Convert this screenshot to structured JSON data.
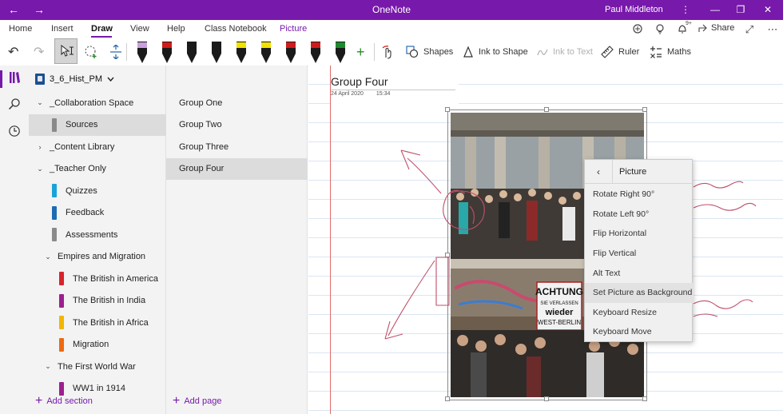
{
  "window": {
    "app_title": "OneNote",
    "user_name": "Paul Middleton",
    "back_glyph": "←",
    "forward_glyph": "→",
    "more_glyph": "⋮",
    "minimize_glyph": "—",
    "restore_glyph": "❐",
    "close_glyph": "✕"
  },
  "menu": {
    "tabs": [
      "Home",
      "Insert",
      "Draw",
      "View",
      "Help",
      "Class Notebook",
      "Picture"
    ],
    "active_tab": "Draw",
    "notification_count": "9+",
    "share_label": "Share",
    "expand_glyph": "⤢",
    "more_glyph": "⋯"
  },
  "ribbon": {
    "undo_glyph": "↶",
    "redo_glyph": "↷",
    "lasso_glyph": "◌",
    "space_glyph": "⇕",
    "add_pen_glyph": "+",
    "shapes_label": "Shapes",
    "ink_to_shape_label": "Ink to Shape",
    "ink_to_text_label": "Ink to Text",
    "ruler_label": "Ruler",
    "maths_label": "Maths",
    "pens": [
      {
        "body": "#1a1a1a",
        "tip": "#1a1a1a",
        "band": "#c9a0dc"
      },
      {
        "body": "#1a1a1a",
        "tip": "#1a1a1a",
        "band": "#d11b1b"
      },
      {
        "body": "#1a1a1a",
        "tip": "#1a1a1a",
        "band": "#1a1a1a"
      },
      {
        "body": "#1a1a1a",
        "tip": "#1a1a1a",
        "band": "#1a1a1a"
      },
      {
        "body": "#1a1a1a",
        "tip": "#1a1a1a",
        "band": "#f2e200"
      },
      {
        "body": "#1a1a1a",
        "tip": "#1a1a1a",
        "band": "#f2e200"
      },
      {
        "body": "#1a1a1a",
        "tip": "#1a1a1a",
        "band": "#d11b1b"
      },
      {
        "body": "#1a1a1a",
        "tip": "#1a1a1a",
        "band": "#d11b1b"
      },
      {
        "body": "#1a1a1a",
        "tip": "#1a1a1a",
        "band": "#1d8a2e"
      }
    ]
  },
  "notebook": {
    "name": "3_6_Hist_PM",
    "sort_glyph": "⇅",
    "sections": [
      {
        "label": "_Collaboration Space",
        "kind": "group",
        "chevron": "⌄",
        "indent": 0,
        "color": ""
      },
      {
        "label": "Sources",
        "kind": "section",
        "chevron": "",
        "indent": 1,
        "color": "#8a8a8a",
        "selected": true
      },
      {
        "label": "_Content Library",
        "kind": "group",
        "chevron": "›",
        "indent": 0,
        "color": ""
      },
      {
        "label": "_Teacher Only",
        "kind": "group",
        "chevron": "⌄",
        "indent": 0,
        "color": ""
      },
      {
        "label": "Quizzes",
        "kind": "section",
        "chevron": "",
        "indent": 1,
        "color": "#19a3d9"
      },
      {
        "label": "Feedback",
        "kind": "section",
        "chevron": "",
        "indent": 1,
        "color": "#1d6bb5"
      },
      {
        "label": "Assessments",
        "kind": "section",
        "chevron": "",
        "indent": 1,
        "color": "#8a8a8a"
      },
      {
        "label": "Empires and Migration",
        "kind": "group",
        "chevron": "⌄",
        "indent": 1,
        "color": ""
      },
      {
        "label": "The British in America",
        "kind": "section",
        "chevron": "",
        "indent": 2,
        "color": "#d8232a"
      },
      {
        "label": "The British in India",
        "kind": "section",
        "chevron": "",
        "indent": 2,
        "color": "#9c1f8e"
      },
      {
        "label": "The British in Africa",
        "kind": "section",
        "chevron": "",
        "indent": 2,
        "color": "#f2b600"
      },
      {
        "label": "Migration",
        "kind": "section",
        "chevron": "",
        "indent": 2,
        "color": "#ec6a12"
      },
      {
        "label": "The First World War",
        "kind": "group",
        "chevron": "⌄",
        "indent": 1,
        "color": ""
      },
      {
        "label": "WW1 in 1914",
        "kind": "section",
        "chevron": "",
        "indent": 2,
        "color": "#9c1f8e"
      }
    ],
    "add_section_label": "Add section"
  },
  "pages": {
    "items": [
      "Group One",
      "Group Two",
      "Group Three",
      "Group Four"
    ],
    "selected": "Group Four",
    "add_page_label": "Add page"
  },
  "page": {
    "title": "Group Four",
    "date": "24 April 2020",
    "time": "15:34",
    "ink_color": "#c0506a"
  },
  "picture": {
    "sign_lines": [
      "ACHTUNG",
      "SIE VERLASSEN",
      "wieder",
      "WEST-BERLIN"
    ]
  },
  "context_menu": {
    "back_glyph": "‹",
    "title": "Picture",
    "items": [
      "Rotate Right 90°",
      "Rotate Left 90°",
      "Flip Horizontal",
      "Flip Vertical",
      "Alt Text",
      "Set Picture as Background",
      "Keyboard Resize",
      "Keyboard Move"
    ],
    "highlighted": "Set Picture as Background"
  }
}
